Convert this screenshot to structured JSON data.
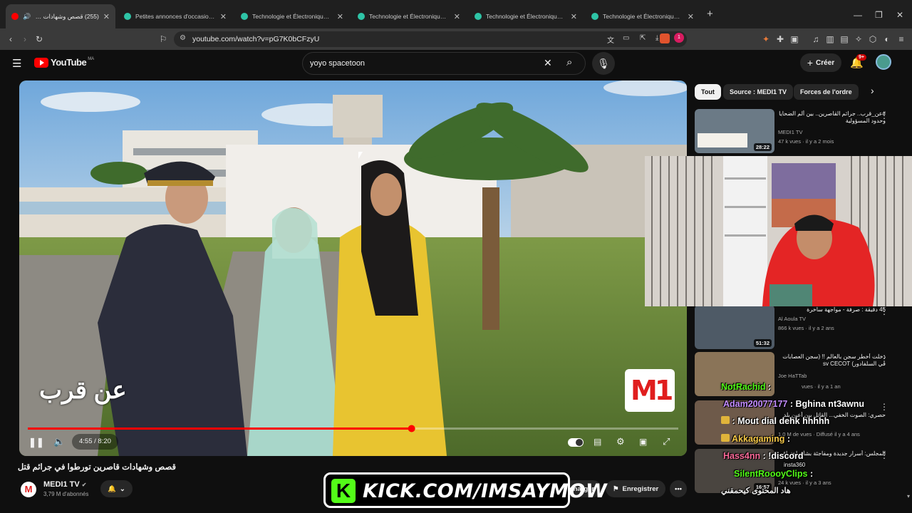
{
  "browser": {
    "tabs": [
      {
        "label": "(255) قصص وشهادات قاصرين",
        "favicon_color": "#ff0000",
        "active": true
      },
      {
        "label": "Petites annonces d'occasion, gratuite",
        "favicon_color": "#2ec4a6",
        "active": false
      },
      {
        "label": "Technologie et Électronique d'Occasi",
        "favicon_color": "#2ec4a6",
        "active": false
      },
      {
        "label": "Technologie et Électronique d'Occasi",
        "favicon_color": "#2ec4a6",
        "active": false
      },
      {
        "label": "Technologie et Électronique d'Occasi",
        "favicon_color": "#2ec4a6",
        "active": false
      },
      {
        "label": "Technologie et Électronique d'Occasi",
        "favicon_color": "#2ec4a6",
        "active": false
      }
    ],
    "url": "youtube.com/watch?v=pG7K0bCFzyU",
    "extension_badge": "1"
  },
  "youtube": {
    "logo_text": "YouTube",
    "region": "MA",
    "search_value": "yoyo spacetoon",
    "create_label": "Créer",
    "notif_count": "9+"
  },
  "player": {
    "time": "4:55 / 8:20",
    "progress_fraction": 0.59,
    "watermark_left": "عن قرب",
    "watermark_right": "M1"
  },
  "video_info": {
    "title": "قصص وشهادات قاصرين تورطوا في جرائم قتل",
    "channel": "MEDI1 TV",
    "subscribers": "3,79 M d'abonnés",
    "download_label": "écharger",
    "save_label": "Enregistrer"
  },
  "chips": [
    {
      "label": "Tout",
      "active": true
    },
    {
      "label": "Source : MEDI1 TV",
      "active": false
    },
    {
      "label": "Forces de l'ordre",
      "active": false
    }
  ],
  "sidebar": {
    "items": [
      {
        "title": "#عن_قرب.. جرائم القاصرين.. بين ألم الضحايا وحدود المسؤولية",
        "channel": "MEDI1 TV",
        "meta": "47 k vues · il y a 2 mois",
        "duration": "28:22",
        "thumb_color": "#6b7a86"
      },
      {
        "title": "45 دقيقة : صرفة - مواجهة ساخرة",
        "channel": "Al Aoula TV",
        "meta": "866 k vues · il y a 2 ans",
        "duration": "51:32",
        "thumb_color": "#4e5a66"
      },
      {
        "title": "دخلت أخطر سجن بالعالم !! (سجن العصابات في السلفادور) sv CECOT",
        "channel": "Joe HaTTab",
        "meta": "vues · il y a 1 an",
        "duration": "",
        "thumb_color": "#8a7458"
      },
      {
        "title": "حصري: الصوت الخفي... القاتل بين أعين بلد",
        "channel": "",
        "meta": "1,0 M de vues · Diffusé il y a 4 ans",
        "duration": "",
        "thumb_color": "#6e5a4a"
      },
      {
        "title": "المجلس: أسرار جديدة ومفاجئة بشأن اختراق",
        "channel": "",
        "meta": "24 k vues · il y a 3 ans",
        "duration": "16:57",
        "thumb_color": "#4a4540"
      }
    ]
  },
  "chat": [
    {
      "name": "NotRachid",
      "message": ":",
      "badge": "sub"
    },
    {
      "name": "Adam20077177",
      "message": ": Bghina nt3awnu",
      "badge": ""
    },
    {
      "name": "",
      "message": ": Mout dial dehk hhhhh",
      "badge": "gift"
    },
    {
      "name": "Akkagaming",
      "message": ":",
      "badge": "gift"
    },
    {
      "name": "Hass4nn",
      "message": ": !discord",
      "badge": ""
    },
    {
      "name": "SilentRoooyClips",
      "message": ":",
      "badge": ""
    }
  ],
  "overlay_text": {
    "insta": "insta360",
    "bottom_arabic": "هاد المحتوى كيحمقني"
  },
  "kick_banner": {
    "text": "KICK.COM/IMSAYMOW",
    "color": "#53fc18"
  },
  "colors": {
    "accent_red": "#ff0000",
    "kick_green": "#53fc18"
  }
}
